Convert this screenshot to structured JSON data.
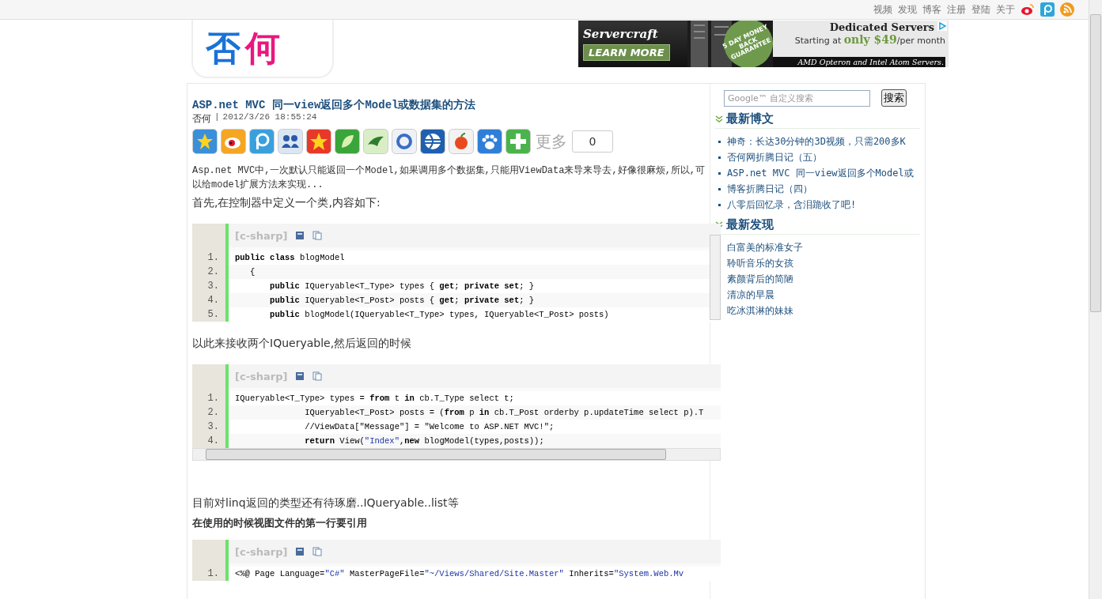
{
  "top_nav": {
    "links": [
      "视频",
      "发现",
      "博客",
      "注册",
      "登陆",
      "关于"
    ]
  },
  "logo": {
    "first": "否",
    "second": "何"
  },
  "ad": {
    "brand": "Servercraft",
    "cta": "LEARN MORE",
    "badge": "5 DAY MONEY BACK GUARANTEE",
    "headline": "Dedicated Servers",
    "offer_prefix": "Starting at ",
    "offer_price": "only $49",
    "offer_suffix": "/per month",
    "footer": "AMD Opteron and  Intel Atom Servers."
  },
  "post": {
    "title": "ASP.net MVC 同一view返回多个Model或数据集的方法",
    "author": "否何",
    "separator": "|",
    "date": "2012/3/26 18:55:24",
    "share": {
      "more": "更多",
      "count": "0"
    },
    "body": [
      {
        "kind": "intro",
        "text": "Asp.net MVC中,一次默认只能返回一个Model,如果调用多个数据集,只能用ViewData来导来导去,好像很麻烦,所以,可以给model扩展方法来实现..."
      },
      {
        "kind": "text",
        "text": "首先,在控制器中定义一个类,内容如下:"
      },
      {
        "kind": "code",
        "language": "[c-sharp]",
        "vertical_scrollbar": true,
        "horizontal_scrollbar": false,
        "lines": [
          {
            "number": "1.",
            "tokens": [
              {
                "text": "public class",
                "kind": "keyword"
              },
              {
                "text": " blogModel",
                "kind": "plain"
              }
            ]
          },
          {
            "number": "2.",
            "tokens": [
              {
                "text": "   {",
                "kind": "plain"
              }
            ]
          },
          {
            "number": "3.",
            "tokens": [
              {
                "text": "       public",
                "kind": "keyword"
              },
              {
                "text": " IQueryable<T_Type> types { ",
                "kind": "plain"
              },
              {
                "text": "get",
                "kind": "keyword"
              },
              {
                "text": "; ",
                "kind": "plain"
              },
              {
                "text": "private set",
                "kind": "keyword"
              },
              {
                "text": "; }",
                "kind": "plain"
              }
            ]
          },
          {
            "number": "4.",
            "tokens": [
              {
                "text": "       public",
                "kind": "keyword"
              },
              {
                "text": " IQueryable<T_Post> posts { ",
                "kind": "plain"
              },
              {
                "text": "get",
                "kind": "keyword"
              },
              {
                "text": "; ",
                "kind": "plain"
              },
              {
                "text": "private set",
                "kind": "keyword"
              },
              {
                "text": "; }",
                "kind": "plain"
              }
            ]
          },
          {
            "number": "5.",
            "tokens": [
              {
                "text": "       public",
                "kind": "keyword"
              },
              {
                "text": " blogModel(IQueryable<T_Type> types, IQueryable<T_Post> posts)",
                "kind": "plain"
              }
            ]
          }
        ]
      },
      {
        "kind": "text",
        "text": "以此来接收两个IQueryable,然后返回的时候"
      },
      {
        "kind": "code",
        "language": "[c-sharp]",
        "vertical_scrollbar": false,
        "horizontal_scrollbar": true,
        "lines": [
          {
            "number": "1.",
            "tokens": [
              {
                "text": "IQueryable<T_Type> types = ",
                "kind": "plain"
              },
              {
                "text": "from",
                "kind": "keyword"
              },
              {
                "text": " t ",
                "kind": "plain"
              },
              {
                "text": "in",
                "kind": "keyword"
              },
              {
                "text": " cb.T_Type select t;",
                "kind": "plain"
              }
            ]
          },
          {
            "number": "2.",
            "tokens": [
              {
                "text": "              IQueryable<T_Post> posts = (",
                "kind": "plain"
              },
              {
                "text": "from",
                "kind": "keyword"
              },
              {
                "text": " p ",
                "kind": "plain"
              },
              {
                "text": "in",
                "kind": "keyword"
              },
              {
                "text": " cb.T_Post orderby p.updateTime select p).T",
                "kind": "plain"
              }
            ]
          },
          {
            "number": "3.",
            "tokens": [
              {
                "text": "              //ViewData[\"Message\"] = \"Welcome to ASP.NET MVC!\";",
                "kind": "plain"
              }
            ]
          },
          {
            "number": "4.",
            "tokens": [
              {
                "text": "              return",
                "kind": "keyword"
              },
              {
                "text": " View(",
                "kind": "plain"
              },
              {
                "text": "\"Index\"",
                "kind": "string"
              },
              {
                "text": ",",
                "kind": "plain"
              },
              {
                "text": "new",
                "kind": "keyword"
              },
              {
                "text": " blogModel(types,posts));",
                "kind": "plain"
              }
            ]
          }
        ]
      },
      {
        "kind": "spacer"
      },
      {
        "kind": "text",
        "text": "目前对linq返回的类型还有待琢磨..IQueryable..list等"
      },
      {
        "kind": "bold",
        "text": "在使用的时候视图文件的第一行要引用"
      },
      {
        "kind": "code",
        "language": "[c-sharp]",
        "vertical_scrollbar": false,
        "horizontal_scrollbar": false,
        "lines": [
          {
            "number": "1.",
            "tokens": [
              {
                "text": "<%@ Page Language=",
                "kind": "plain"
              },
              {
                "text": "\"C#\"",
                "kind": "string"
              },
              {
                "text": " MasterPageFile=",
                "kind": "plain"
              },
              {
                "text": "\"~/Views/Shared/Site.Master\"",
                "kind": "string"
              },
              {
                "text": " Inherits=",
                "kind": "plain"
              },
              {
                "text": "\"System.Web.Mv",
                "kind": "string"
              }
            ]
          }
        ]
      }
    ]
  },
  "sidebar": {
    "search": {
      "placeholder": "Google™ 自定义搜索",
      "button": "搜索"
    },
    "sections": [
      {
        "heading": "最新博文",
        "items": [
          "神奇：长达30分钟的3D视频，只需200多K",
          "否何网折腾日记（五）",
          "ASP.net MVC 同一view返回多个Model或",
          "博客折腾日记（四）",
          "八零后回忆录，含泪跪收了吧!"
        ]
      },
      {
        "heading": "最新发现",
        "items": [
          "白富美的标准女子",
          "聆听音乐的女孩",
          "素颜背后的简陋",
          "清凉的早晨",
          "吃冰淇淋的妹妹"
        ]
      }
    ]
  }
}
